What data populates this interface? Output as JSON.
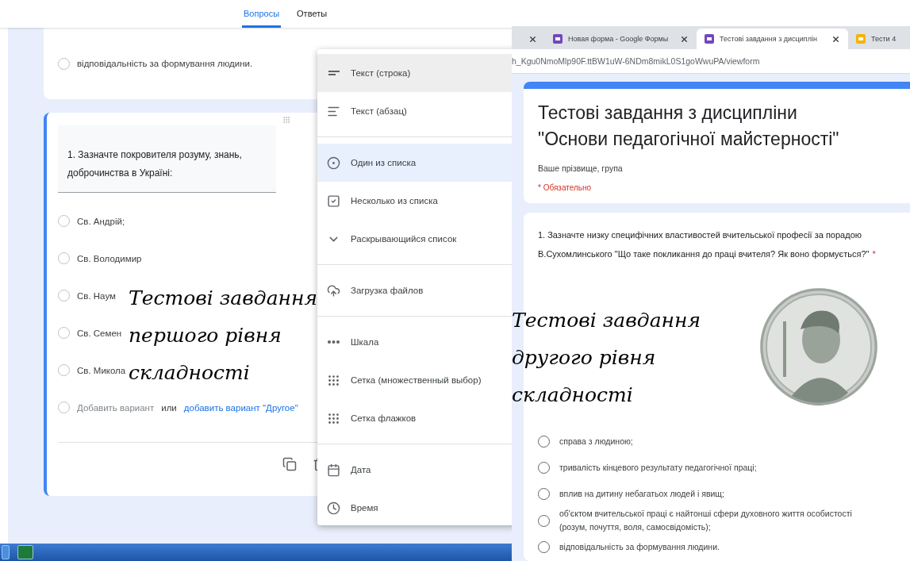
{
  "editor": {
    "tabs": [
      {
        "label": "Вопросы",
        "selected": true
      },
      {
        "label": "Ответы",
        "selected": false
      }
    ],
    "top_card": {
      "options": [
        {
          "label": "відповідальність за формування людини.",
          "selected": false
        }
      ]
    },
    "question_card": {
      "question": "1. Зазначте покровителя розуму, знань, доброчинства в Україні:",
      "options": [
        {
          "label": "Св. Андрій;",
          "selected": false
        },
        {
          "label": "Св. Володимир",
          "selected": false
        },
        {
          "label": "Св. Наум",
          "selected": false
        },
        {
          "label": "Св. Семен",
          "selected": false
        },
        {
          "label": "Св. Микола",
          "selected": false
        }
      ],
      "add_option": "Добавить вариант",
      "add_option_selected": false,
      "or": "или",
      "add_other": "добавить вариант \"Другое\""
    },
    "caption": {
      "lines": [
        "Тестові завдання",
        "першого рівня",
        "складності"
      ]
    },
    "type_menu": [
      [
        {
          "kind": "short_text",
          "label": "Текст (строка)",
          "hovered": true,
          "selected": false
        },
        {
          "kind": "paragraph",
          "label": "Текст (абзац)",
          "hovered": false,
          "selected": false
        }
      ],
      [
        {
          "kind": "radio",
          "label": "Один из списка",
          "hovered": false,
          "selected": true
        },
        {
          "kind": "checkbox",
          "label": "Несколько из списка",
          "hovered": false,
          "selected": false
        },
        {
          "kind": "dropdown",
          "label": "Раскрывающийся список",
          "hovered": false,
          "selected": false
        }
      ],
      [
        {
          "kind": "upload",
          "label": "Загрузка файлов",
          "hovered": false,
          "selected": false
        }
      ],
      [
        {
          "kind": "scale",
          "label": "Шкала",
          "hovered": false,
          "selected": false
        },
        {
          "kind": "grid",
          "label": "Сетка (множественный выбор)",
          "hovered": false,
          "selected": false
        },
        {
          "kind": "checkbox_grid",
          "label": "Сетка флажков",
          "hovered": false,
          "selected": false
        }
      ],
      [
        {
          "kind": "date",
          "label": "Дата",
          "hovered": false,
          "selected": false
        },
        {
          "kind": "time",
          "label": "Время",
          "hovered": false,
          "selected": false
        }
      ]
    ]
  },
  "browser": {
    "tabs": [
      {
        "kind": "blank",
        "selected": false
      },
      {
        "kind": "forms",
        "title": "Новая форма - Google Формы",
        "selected": false
      },
      {
        "kind": "forms",
        "title": "Тестові завдання з дисциплін",
        "selected": true
      },
      {
        "kind": "slides",
        "title": "Тести 4",
        "selected": false
      }
    ],
    "url": "h_Kgu0NmoMlp90F.ttBW1uW-6NDm8mikL0S1goWwuPA/viewform",
    "form": {
      "title": "Тестові завдання з дисципліни \"Основи педагогічної майстерності\"",
      "description": "Ваше прізвище, група",
      "required_note": "* Обязательно",
      "question": "1. Зазначте низку специфічних властивостей вчительської професії за порадою В.Сухомлинського \"Що таке покликання до праці вчителя? Як воно формується?\"",
      "required_mark": "*",
      "options": [
        {
          "label": "справа з людиною;",
          "selected": false
        },
        {
          "label": "тривалість кінцевого результату педагогічної праці;",
          "selected": false
        },
        {
          "label": "вплив на дитину небагатьох людей і явищ;",
          "selected": false
        },
        {
          "label": "об'єктом вчительської праці є найтонші сфери духовного життя особистості (розум, почуття, воля, самосвідомість);",
          "selected": false
        },
        {
          "label": "відповідальність за формування людини.",
          "selected": false
        }
      ]
    },
    "caption": {
      "lines": [
        "Тестові завдання",
        "другого рівня",
        "складності"
      ]
    }
  }
}
